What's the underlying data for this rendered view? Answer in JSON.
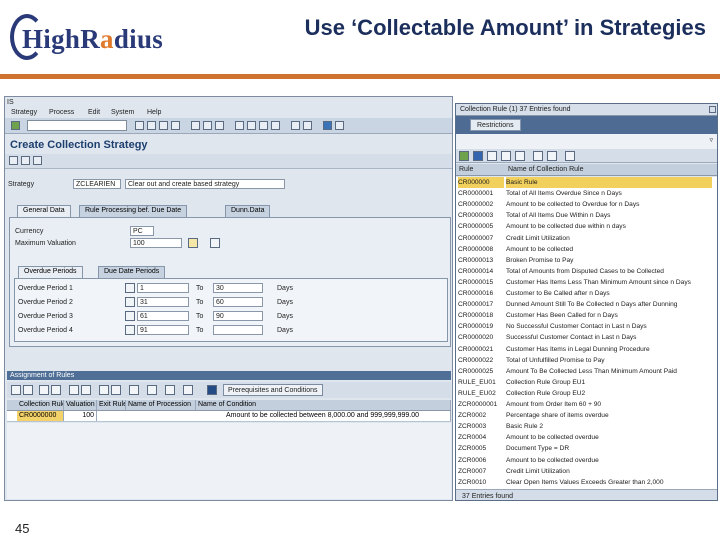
{
  "slide": {
    "logo": {
      "high": "High",
      "radius_r": "R",
      "radius_o": "a",
      "radius_rest": "dius"
    },
    "title": "Use ‘Collectable Amount’ in Strategies",
    "page_number": "45",
    "colors": {
      "accent": "#cf7230",
      "brand": "#2a3a78",
      "title": "#1c2f5c"
    }
  },
  "sap": {
    "corner_label": "IS",
    "menu": [
      "Strategy",
      "Process",
      "Edit",
      "System",
      "Help"
    ],
    "screen_title": "Create Collection Strategy",
    "strategy_label": "Strategy",
    "strategy_value": "ZCLEARIEN",
    "strategy_desc": "Clear out and create based strategy",
    "main_tabs": [
      {
        "label": "General Data",
        "active": true
      },
      {
        "label": "Rule Processing bef. Due Date",
        "active": false
      },
      {
        "label": "Dunn.Data",
        "active": false
      }
    ],
    "general": {
      "currency_label": "Currency",
      "currency_value": "PC",
      "max_valuation_label": "Maximum Valuation",
      "max_valuation_value": "100"
    },
    "overdue_tabs": [
      {
        "label": "Overdue Periods",
        "active": true
      },
      {
        "label": "Due Date Periods",
        "active": false
      }
    ],
    "periods": [
      {
        "label": "Overdue Period 1",
        "from": "1",
        "to_label": "To",
        "to": "30",
        "unit": "Days"
      },
      {
        "label": "Overdue Period 2",
        "from": "31",
        "to_label": "To",
        "to": "60",
        "unit": "Days"
      },
      {
        "label": "Overdue Period 3",
        "from": "61",
        "to_label": "To",
        "to": "90",
        "unit": "Days"
      },
      {
        "label": "Overdue Period 4",
        "from": "91",
        "to_label": "To",
        "to": "",
        "unit": "Days"
      }
    ],
    "assign_label": "Assignment of Rules",
    "prereq_button": "Prerequisites and Conditions",
    "grid_columns": [
      "Collection Rule",
      "Valuation",
      "Exit Rule",
      "Name of Procession",
      "Name of Condition"
    ],
    "grid_row": {
      "rule": "CR0000000",
      "valuation": "100",
      "exit": "",
      "procession": "",
      "condition": "Amount to be collected between 8,000.00 and 999,999,999.00"
    }
  },
  "dialog": {
    "title": "Collection Rule (1) 37 Entries found",
    "tab": "Restrictions",
    "col_rule": "Rule",
    "col_name": "Name of Collection Rule",
    "footer": "37 Entries found",
    "rows": [
      {
        "rule": "CR000000",
        "name": "Basic Rule",
        "selected": true
      },
      {
        "rule": "CR0000001",
        "name": "Total of All Items Overdue Since n Days",
        "selected": false
      },
      {
        "rule": "CR0000002",
        "name": "Amount to be collected to Overdue for n Days",
        "selected": false
      },
      {
        "rule": "CR0000003",
        "name": "Total of All Items Due Within n Days",
        "selected": false
      },
      {
        "rule": "CR0000005",
        "name": "Amount to be collected due within n days",
        "selected": false
      },
      {
        "rule": "CR0000007",
        "name": "Credit Limit Utilization",
        "selected": false
      },
      {
        "rule": "CR0000008",
        "name": "Amount to be collected",
        "selected": false
      },
      {
        "rule": "CR0000013",
        "name": "Broken Promise to Pay",
        "selected": false
      },
      {
        "rule": "CR0000014",
        "name": "Total of Amounts from Disputed Cases to be Collected",
        "selected": false
      },
      {
        "rule": "CR0000015",
        "name": "Customer Has Items Less Than Minimum Amount since n Days",
        "selected": false
      },
      {
        "rule": "CR0000016",
        "name": "Customer to Be Called after n Days",
        "selected": false
      },
      {
        "rule": "CR0000017",
        "name": "Dunned Amount Still To Be Collected n Days after Dunning",
        "selected": false
      },
      {
        "rule": "CR0000018",
        "name": "Customer Has Been Called for n Days",
        "selected": false
      },
      {
        "rule": "CR0000019",
        "name": "No Successful Customer Contact in Last n Days",
        "selected": false
      },
      {
        "rule": "CR0000020",
        "name": "Successful Customer Contact in Last n Days",
        "selected": false
      },
      {
        "rule": "CR0000021",
        "name": "Customer Has Items in Legal Dunning Procedure",
        "selected": false
      },
      {
        "rule": "CR0000022",
        "name": "Total of Unfulfilled Promise to Pay",
        "selected": false
      },
      {
        "rule": "CR0000025",
        "name": "Amount To Be Collected Less Than Minimum Amount Paid",
        "selected": false
      },
      {
        "rule": "RULE_EU01",
        "name": "Collection Rule Group EU1",
        "selected": false
      },
      {
        "rule": "RULE_EU02",
        "name": "Collection Rule Group EU2",
        "selected": false
      },
      {
        "rule": "ZCR0000001",
        "name": "Amount from Order Item 60 + 90",
        "selected": false
      },
      {
        "rule": "ZCR0002",
        "name": "Percentage share of items overdue",
        "selected": false
      },
      {
        "rule": "ZCR0003",
        "name": "Basic Rule 2",
        "selected": false
      },
      {
        "rule": "ZCR0004",
        "name": "Amount to be collected overdue",
        "selected": false
      },
      {
        "rule": "ZCR0005",
        "name": "Document Type = DR",
        "selected": false
      },
      {
        "rule": "ZCR0006",
        "name": "Amount to be collected overdue",
        "selected": false
      },
      {
        "rule": "ZCR0007",
        "name": "Credit Limit Utilization",
        "selected": false
      },
      {
        "rule": "ZCR0010",
        "name": "Clear Open Items Values Exceeds Greater than 2,000",
        "selected": false
      }
    ]
  }
}
